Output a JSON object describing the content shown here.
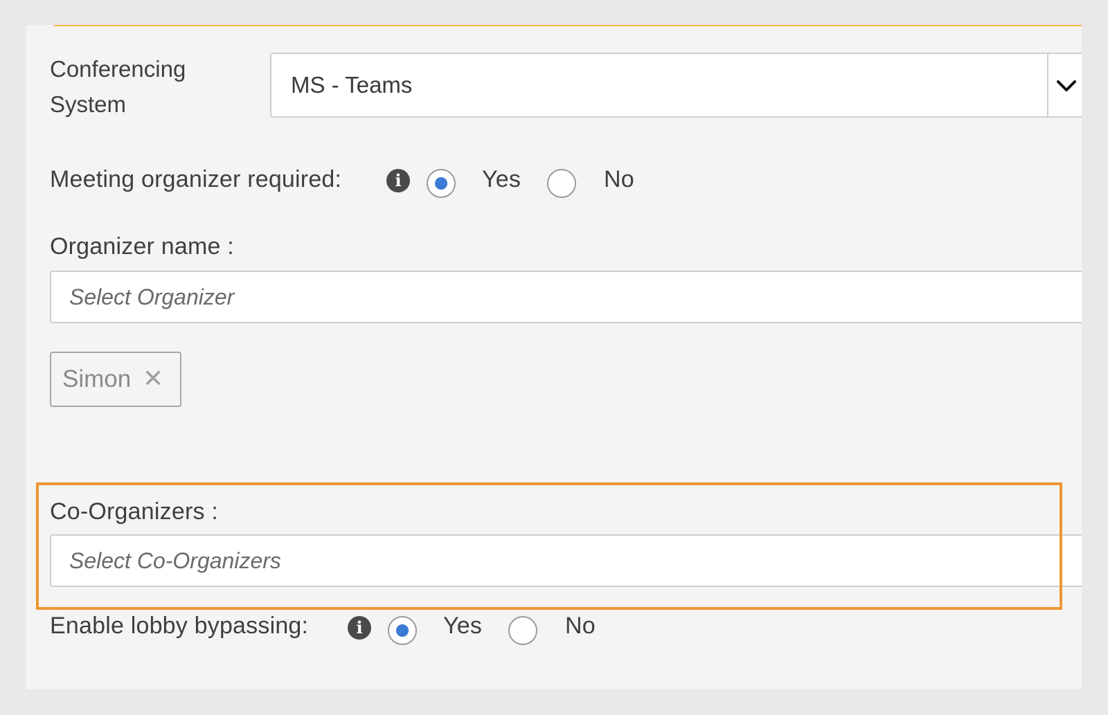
{
  "colors": {
    "accent": "#f0b94a",
    "highlight": "#ee9632",
    "radio_selected": "#3a7bd5"
  },
  "conferencing": {
    "label": "Conferencing System",
    "label_line1": "Conferencing",
    "label_line2": "System",
    "value": "MS - Teams",
    "chevron_icon": "chevron-down-icon"
  },
  "meeting_organizer": {
    "label": "Meeting organizer required:",
    "info_icon": "info-icon",
    "yes_label": "Yes",
    "no_label": "No",
    "selected": "Yes"
  },
  "organizer": {
    "label": "Organizer name :",
    "placeholder": "Select Organizer",
    "chips": [
      {
        "label": "Simon",
        "remove_icon": "close-icon"
      }
    ]
  },
  "co_organizers": {
    "label": "Co-Organizers :",
    "placeholder": "Select Co-Organizers"
  },
  "lobby_bypass": {
    "label": "Enable lobby bypassing:",
    "info_icon": "info-icon",
    "yes_label": "Yes",
    "no_label": "No",
    "selected": "Yes"
  }
}
